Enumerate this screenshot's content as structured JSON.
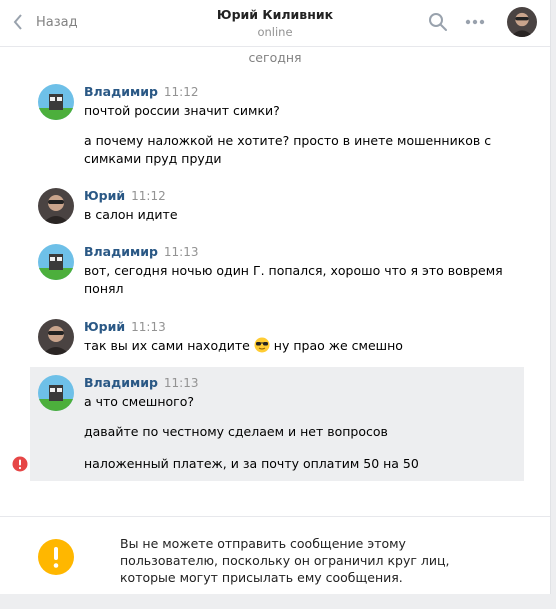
{
  "header": {
    "back_label": "Назад",
    "title": "Юрий Киливник",
    "status": "online"
  },
  "date_separator": "сегодня",
  "messages": [
    {
      "author": "Владимир",
      "time": "11:12",
      "avatar": "vladimir",
      "lines": [
        "почтой россии значит симки?",
        "",
        "а почему наложкой не хотите? просто в инете мошенников с",
        "симками пруд пруди"
      ]
    },
    {
      "author": "Юрий",
      "time": "11:12",
      "avatar": "yuriy",
      "lines": [
        "в салон идите"
      ]
    },
    {
      "author": "Владимир",
      "time": "11:13",
      "avatar": "vladimir",
      "lines": [
        "вот, сегодня ночью один Г. попался, хорошо что я это вовремя",
        "понял"
      ]
    },
    {
      "author": "Юрий",
      "time": "11:13",
      "avatar": "yuriy",
      "text_before_emoji": "так вы их сами находите ",
      "emoji": "sunglasses-emoji",
      "text_after_emoji": " ну прао же смешно"
    },
    {
      "author": "Владимир",
      "time": "11:13",
      "avatar": "vladimir",
      "highlighted": true,
      "lines": [
        "а что смешного?",
        "",
        "давайте по честному сделаем и нет вопросов",
        "",
        "наложенный платеж, и за почту оплатим 50 на 50"
      ]
    }
  ],
  "footer": {
    "notice": "Вы не можете отправить сообщение этому пользователю, поскольку он ограничил круг лиц, которые могут присылать ему сообщения."
  },
  "icons": {
    "back": "chevron-left-icon",
    "search": "search-icon",
    "more": "more-dots-icon",
    "error": "error-icon",
    "warning": "warning-icon"
  },
  "colors": {
    "link": "#2a5885",
    "highlight": "#edeef0",
    "error": "#e64646",
    "warning": "#ffb700"
  }
}
